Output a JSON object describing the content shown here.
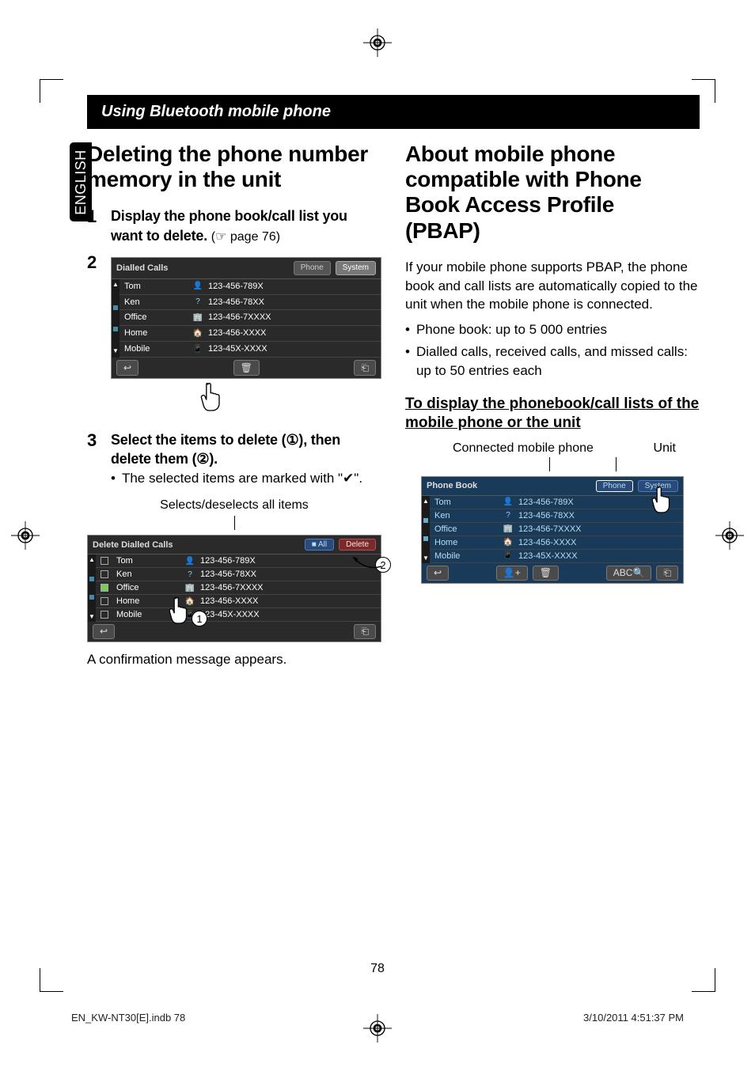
{
  "side_tab": "ENGLISH",
  "banner": "Using Bluetooth mobile phone",
  "left": {
    "heading": "Deleting the phone number memory in the unit",
    "step1_bold": "Display the phone book/call list you want to delete.",
    "step1_sub": "(☞ page 76)",
    "step3_bold": "Select the items to delete (①), then delete them (②).",
    "step3_bullet": "The selected items are marked with \"✔\".",
    "caption_selects": "Selects/deselects all items",
    "confirm_msg": "A confirmation message appears."
  },
  "right": {
    "heading": "About mobile phone compatible with Phone Book Access Profile (PBAP)",
    "para": "If your mobile phone supports PBAP, the phone book and call lists are automatically copied to the unit when the mobile phone is connected.",
    "b1": "Phone book: up to 5 000 entries",
    "b2": "Dialled calls, received calls, and missed calls: up to 50 entries each",
    "subhead": "To display the phonebook/call lists of the mobile phone or the unit",
    "label_left": "Connected mobile phone",
    "label_right": "Unit"
  },
  "ui_dialled": {
    "title": "Dialled Calls",
    "tab_phone": "Phone",
    "tab_system": "System",
    "rows": [
      {
        "name": "Tom",
        "icon": "👤",
        "num": "123-456-789X"
      },
      {
        "name": "Ken",
        "icon": "?",
        "num": "123-456-78XX"
      },
      {
        "name": "Office",
        "icon": "🏢",
        "num": "123-456-7XXXX"
      },
      {
        "name": "Home",
        "icon": "🏠",
        "num": "123-456-XXXX"
      },
      {
        "name": "Mobile",
        "icon": "📱",
        "num": "123-45X-XXXX"
      }
    ]
  },
  "ui_delete": {
    "title": "Delete Dialled Calls",
    "btn_all": "All",
    "btn_delete": "Delete",
    "rows": [
      {
        "name": "Tom",
        "checked": false,
        "icon": "👤",
        "num": "123-456-789X"
      },
      {
        "name": "Ken",
        "checked": false,
        "icon": "?",
        "num": "123-456-78XX"
      },
      {
        "name": "Office",
        "checked": true,
        "icon": "🏢",
        "num": "123-456-7XXXX"
      },
      {
        "name": "Home",
        "checked": false,
        "icon": "🏠",
        "num": "123-456-XXXX"
      },
      {
        "name": "Mobile",
        "checked": false,
        "icon": "📱",
        "num": "123-45X-XXXX"
      }
    ]
  },
  "ui_phonebook": {
    "title": "Phone Book",
    "tab_phone": "Phone",
    "tab_system": "System",
    "abc": "ABC",
    "rows": [
      {
        "name": "Tom",
        "icon": "👤",
        "num": "123-456-789X"
      },
      {
        "name": "Ken",
        "icon": "?",
        "num": "123-456-78XX"
      },
      {
        "name": "Office",
        "icon": "🏢",
        "num": "123-456-7XXXX"
      },
      {
        "name": "Home",
        "icon": "🏠",
        "num": "123-456-XXXX"
      },
      {
        "name": "Mobile",
        "icon": "📱",
        "num": "123-45X-XXXX"
      }
    ]
  },
  "step_nums": {
    "s1": "1",
    "s2": "2",
    "s3": "3"
  },
  "page_number": "78",
  "footer_left": "EN_KW-NT30[E].indb   78",
  "footer_right": "3/10/2011   4:51:37 PM"
}
